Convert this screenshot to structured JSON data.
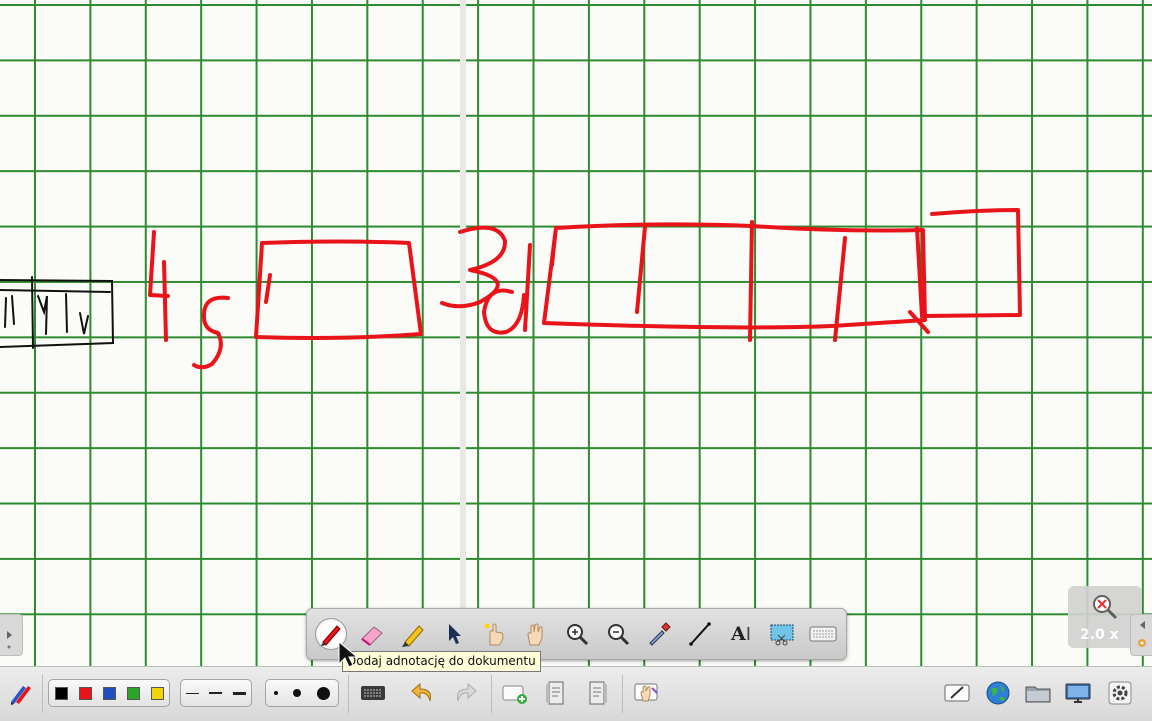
{
  "app": "whiteboard annotation tool",
  "canvas": {
    "grid_color": "#2e8a2e",
    "ink_color": "#e8141a",
    "handwritten_labels": [
      "4",
      "s",
      "3",
      "d"
    ]
  },
  "floating_toolbar": {
    "tools": [
      {
        "name": "pen-tool",
        "active": true
      },
      {
        "name": "eraser-tool"
      },
      {
        "name": "highlighter-tool"
      },
      {
        "name": "pointer-tool"
      },
      {
        "name": "laser-pointer-tool"
      },
      {
        "name": "hand-tool"
      },
      {
        "name": "zoom-in-tool"
      },
      {
        "name": "zoom-out-tool"
      },
      {
        "name": "capture-tool"
      },
      {
        "name": "line-tool"
      },
      {
        "name": "text-tool",
        "label": "A"
      },
      {
        "name": "screenshot-tool"
      },
      {
        "name": "keyboard-tool"
      }
    ]
  },
  "tooltip": {
    "text": "Dodaj adnotację do dokumentu"
  },
  "zoom": {
    "level": "2.0 x"
  },
  "bottom_bar": {
    "colors": [
      "#000000",
      "#e8141a",
      "#1f4fbf",
      "#2aa52a",
      "#f2d40c"
    ],
    "line_widths": [
      "thin",
      "medium",
      "thick"
    ],
    "eraser_sizes": [
      "small",
      "medium",
      "large"
    ],
    "buttons": [
      "virtual-keyboard",
      "undo",
      "redo",
      "new-page",
      "previous-page",
      "next-page",
      "erase-annotations",
      "board-mode",
      "web-mode",
      "documents",
      "desktop-mode",
      "settings"
    ]
  }
}
